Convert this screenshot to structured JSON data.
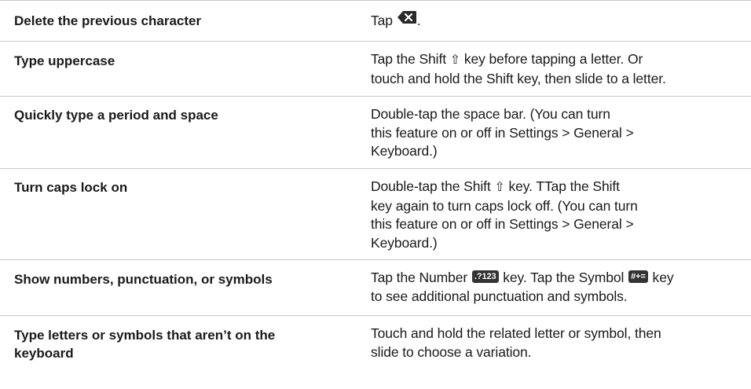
{
  "rows": [
    {
      "action": "Delete the previous character",
      "instruction_parts": [
        "Tap ",
        "."
      ],
      "icon": "delete-key-icon"
    },
    {
      "action": "Type uppercase",
      "line1_a": "Tap the Shift ",
      "line1_b": " key before tapping a letter. Or",
      "line2": "touch and hold the Shift key, then slide to a letter.",
      "icon": "shift-arrow-icon"
    },
    {
      "action": "Quickly type a period and space",
      "lines": [
        "Double-tap the space bar. (You can turn",
        "this feature on or off in Settings > General >",
        "Keyboard.)"
      ]
    },
    {
      "action": "Turn caps lock on",
      "line1_a": "Double-tap the Shift ",
      "line1_b": " key. TTap the Shift",
      "lines_rest": [
        "key again to turn caps lock off. (You can turn",
        "this feature on or off in Settings > General >",
        "Keyboard.)"
      ],
      "icon": "shift-arrow-icon"
    },
    {
      "action": "Show numbers, punctuation, or symbols",
      "line1_a": "Tap the Number ",
      "number_key_label": ".?123",
      "line1_b": " key. Tap the Symbol ",
      "symbol_key_label": "#+=",
      "line1_c": " key",
      "line2": "to see additional punctuation and symbols."
    },
    {
      "action_lines": [
        "Type letters or symbols that aren’t on the",
        "keyboard"
      ],
      "lines": [
        "Touch and hold the related letter or symbol, then",
        "slide to choose a variation."
      ]
    }
  ]
}
